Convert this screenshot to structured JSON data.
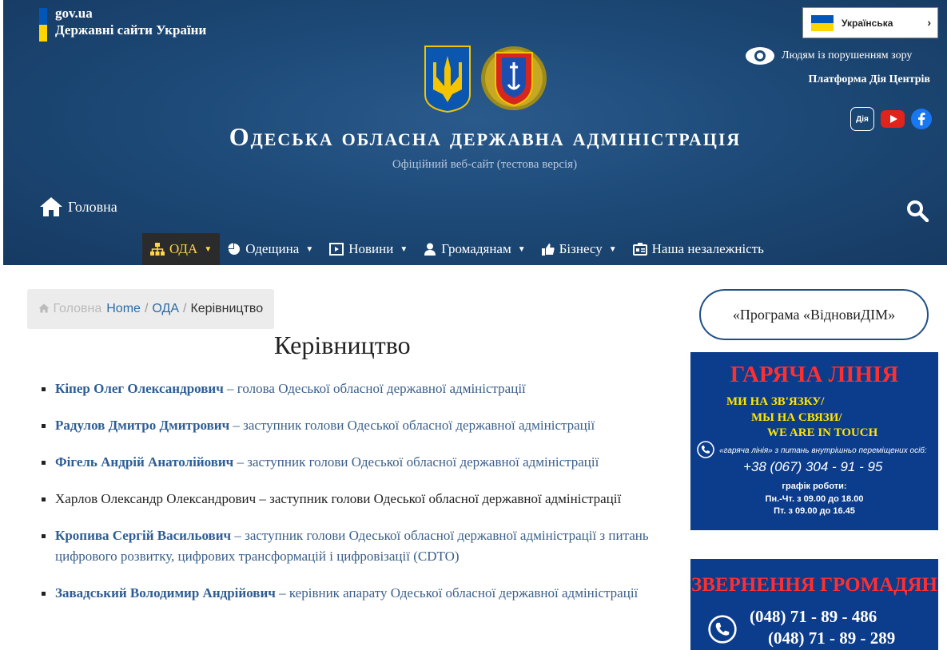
{
  "header": {
    "gov_link": "gov.ua",
    "gov_sub": "Державні сайти України",
    "language": "Українська",
    "vision_link": "Людям із порушенням зору",
    "platform_link": "Платформа Дія Центрів",
    "diia_label": "Дія",
    "org_title": "Одеська обласна державна адміністрація",
    "org_subtitle": "Офіційний веб-сайт (тестова версія)",
    "home_link": "Головна"
  },
  "menu": [
    {
      "label": "ОДА",
      "icon": "sitemap-icon",
      "active": true
    },
    {
      "label": "Одещина",
      "icon": "pie-chart-icon"
    },
    {
      "label": "Новини",
      "icon": "film-icon"
    },
    {
      "label": "Громадянам",
      "icon": "user-icon"
    },
    {
      "label": "Бізнесу",
      "icon": "thumbs-up-icon"
    },
    {
      "label": "Наша незалежність",
      "icon": "id-card-icon"
    }
  ],
  "breadcrumb": {
    "home": "Головна",
    "items": [
      "Home",
      "ОДА"
    ],
    "current": "Керівництво"
  },
  "page_title": "Керівництво",
  "leaders": [
    {
      "name": "Кіпер Олег Олександрович",
      "role": " – голова Одеської обласної державної адміністрації"
    },
    {
      "name": "Радулов Дмитро Дмитрович",
      "role": " – заступник голови Одеської обласної державної адміністрації"
    },
    {
      "name": "Фігель Андрій Анатолійович",
      "role": " – заступник голови Одеської обласної державної адміністрації"
    },
    {
      "name": "Харлов Олександр Олександрович",
      "role": " – заступник голови Одеської обласної державної адміністрації"
    },
    {
      "name": "Кропива Сергій Васильович",
      "role": " – заступник голови Одеської обласної державної адміністрації з питань цифрового розвитку, цифрових трансформацій і цифровізації (CDTO)"
    },
    {
      "name": "Завадський Володимир Андрійович",
      "role": " – керівник апарату Одеської обласної державної адміністрації"
    }
  ],
  "sidebar": {
    "program_button": "«Програма «ВідновиДІМ»",
    "hotline": {
      "title": "ГАРЯЧА ЛІНІЯ",
      "line1": "МИ НА ЗВ'ЯЗКУ/",
      "line2": "МЫ НА СВЯЗИ/",
      "line3": "WE ARE IN TOUCH",
      "note": "«гаряча лінія» з питань внутрішньо переміщених осіб:",
      "phone": "+38 (067) 304 - 91 - 95",
      "sched_title": "графік роботи:",
      "sched1": "Пн.-Чт. з 09.00 до 18.00",
      "sched2": "Пт. з 09.00 до 16.45"
    },
    "appeals": {
      "title": "ЗВЕРНЕННЯ ГРОМАДЯН",
      "phone1": "(048) 71 - 89 - 486",
      "phone2": "(048) 71 - 89 - 289"
    }
  },
  "colors": {
    "header_bg": "#1d4a78",
    "active_menu_text": "#ffd54a",
    "link": "#2d5d94",
    "banner_bg": "#0c3c8c",
    "banner_title": "#ff2f2f"
  }
}
